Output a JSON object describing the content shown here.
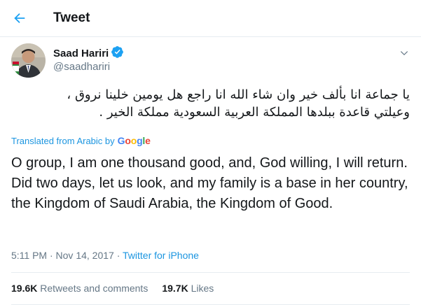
{
  "header": {
    "title": "Tweet"
  },
  "author": {
    "name": "Saad Hariri",
    "handle": "@saadhariri"
  },
  "tweet": {
    "arabic_line1": "يا جماعة انا بألف خير   وان شاء الله انا راجع هل يومين خلينا نروق ،",
    "arabic_line2": "وعيلتي قاعدة ببلدها المملكة العربية السعودية مملكة الخير .",
    "translated_label": "Translated from Arabic by",
    "translator": "Google",
    "translation": "O group, I am one thousand good, and, God willing, I will return. Did two days, let us look, and my family is a base in her country, the Kingdom of Saudi Arabia, the Kingdom of Good.",
    "time": "5:11 PM · Nov 14, 2017 · ",
    "source": "Twitter for iPhone"
  },
  "stats": {
    "retweets_count": "19.6K",
    "retweets_label": "Retweets and comments",
    "likes_count": "19.7K",
    "likes_label": "Likes"
  },
  "colors": {
    "accent": "#1da1f2",
    "link": "#1b95e0",
    "muted": "#657786"
  },
  "icons": [
    "back-arrow-icon",
    "verified-badge-icon",
    "chevron-down-icon"
  ]
}
